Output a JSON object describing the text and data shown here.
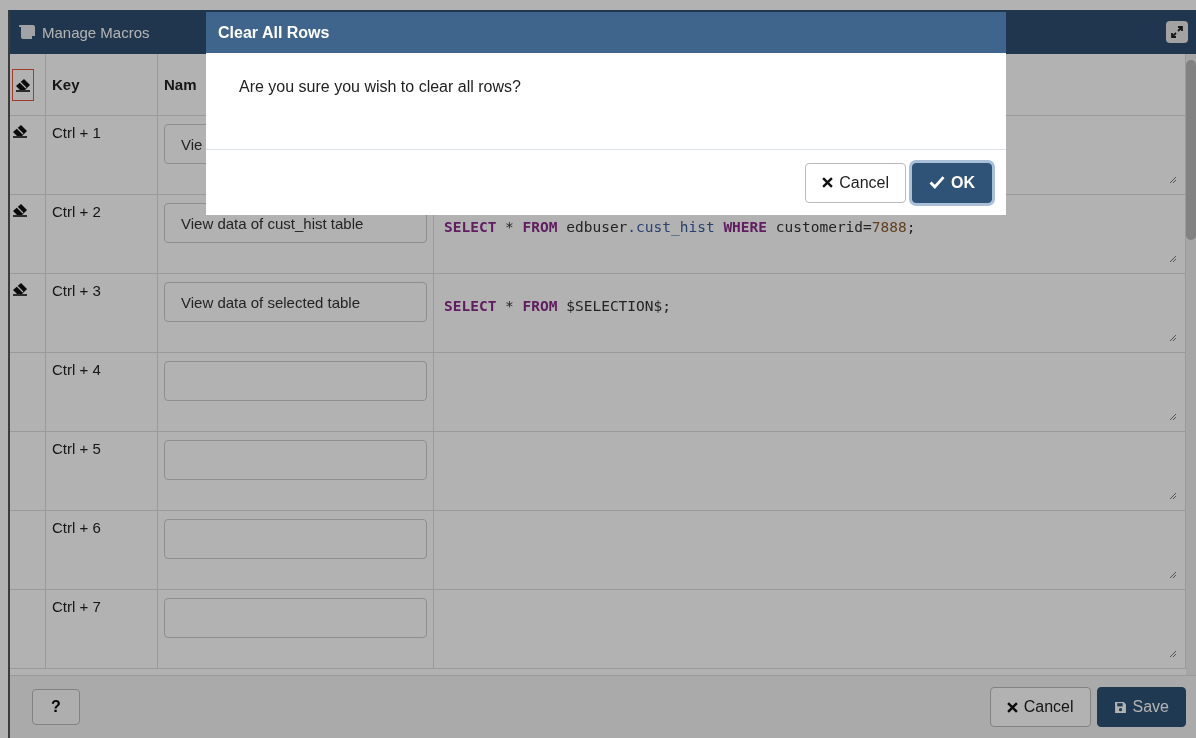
{
  "window": {
    "title": "Manage Macros"
  },
  "table": {
    "columns": [
      {
        "label": "Key"
      },
      {
        "label": "Nam"
      }
    ],
    "clear_all_focused": true,
    "rows": [
      {
        "key": "Ctrl + 1",
        "clearable": true,
        "name": "Vie",
        "sql": []
      },
      {
        "key": "Ctrl + 2",
        "clearable": true,
        "name": "View data of cust_hist table",
        "sql": [
          {
            "kind": "keyword",
            "text": "SELECT"
          },
          {
            "kind": "plain",
            "text": " * "
          },
          {
            "kind": "keyword",
            "text": "FROM"
          },
          {
            "kind": "plain",
            "text": " edbuser"
          },
          {
            "kind": "property",
            "text": ".cust_hist "
          },
          {
            "kind": "keyword",
            "text": "WHERE"
          },
          {
            "kind": "plain",
            "text": " customerid="
          },
          {
            "kind": "number",
            "text": "7888"
          },
          {
            "kind": "plain",
            "text": ";"
          }
        ]
      },
      {
        "key": "Ctrl + 3",
        "clearable": true,
        "name": "View data of selected table",
        "sql": [
          {
            "kind": "keyword",
            "text": "SELECT"
          },
          {
            "kind": "plain",
            "text": " * "
          },
          {
            "kind": "keyword",
            "text": "FROM"
          },
          {
            "kind": "plain",
            "text": " $SELECTION$;"
          }
        ]
      },
      {
        "key": "Ctrl + 4",
        "clearable": false,
        "name": "",
        "sql": []
      },
      {
        "key": "Ctrl + 5",
        "clearable": false,
        "name": "",
        "sql": []
      },
      {
        "key": "Ctrl + 6",
        "clearable": false,
        "name": "",
        "sql": []
      },
      {
        "key": "Ctrl + 7",
        "clearable": false,
        "name": "",
        "sql": []
      }
    ]
  },
  "footer": {
    "help": "?",
    "cancel": "Cancel",
    "save": "Save"
  },
  "modal": {
    "title": "Clear All Rows",
    "message": "Are you sure you wish to clear all rows?",
    "cancel": "Cancel",
    "ok": "OK"
  }
}
